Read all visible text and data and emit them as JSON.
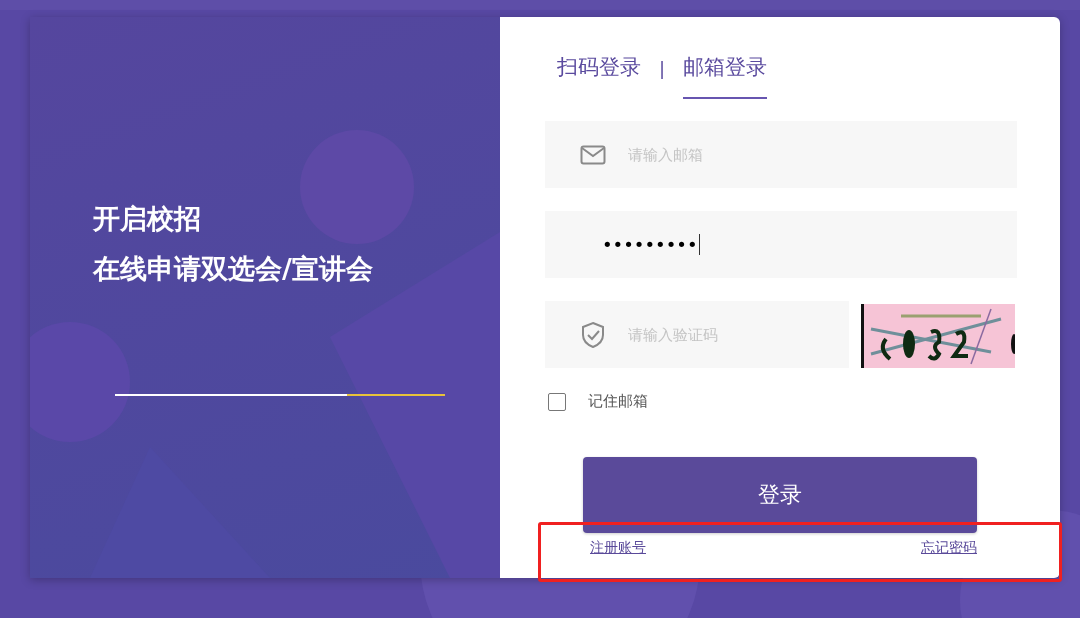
{
  "promo": {
    "lines": [
      "开启校招",
      "在线申请双选会/宣讲会"
    ]
  },
  "tabs": [
    {
      "label": "扫码登录",
      "selected": false
    },
    {
      "label": "邮箱登录",
      "selected": true
    }
  ],
  "tab_separator": "|",
  "email_field": {
    "placeholder": "请输入邮箱"
  },
  "password_field": {
    "value": "•••••••••"
  },
  "captcha_field": {
    "placeholder": "请输入验证码"
  },
  "remember": {
    "label": "记住邮箱",
    "checked": false
  },
  "login_button": "登录",
  "links": [
    "注册账号",
    "忘记密码"
  ]
}
